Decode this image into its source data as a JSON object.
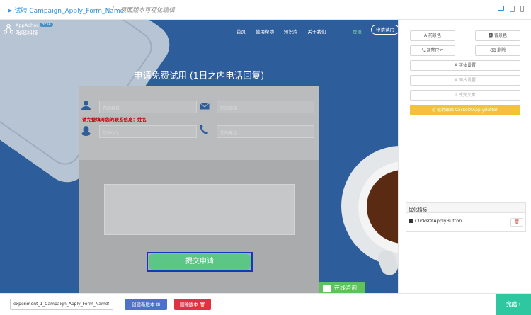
{
  "topbar": {
    "title": "试验 Campaign_Apply_Form_Name",
    "separator": "/",
    "subtitle": "页面版本可视化编辑"
  },
  "site": {
    "logo_en": "AppAdhoc",
    "logo_beta": "BETA",
    "logo_cn": "吆喝科技",
    "nav": [
      "首页",
      "使用帮助",
      "知识库",
      "关于我们"
    ],
    "login": "登录",
    "trial": "申请试用",
    "headline": "申请免费试用 (1日之内电话回复)",
    "form": {
      "name_placeholder": "您的姓名",
      "email_placeholder": "您的邮箱",
      "qq_placeholder": "您的QQ",
      "phone_placeholder": "您的电话",
      "error": "请完整填写您的联系信息：姓名",
      "submit": "提交申请"
    },
    "chat": "在线咨询"
  },
  "panel": {
    "foreground": "前景色",
    "background": "背景色",
    "resize": "调整尺寸",
    "delete": "删除",
    "font": "字体设置",
    "image": "图片设置",
    "text": "改变文本",
    "tracking": "取消跟踪 ClicksOfApplyButton",
    "metrics_title": "优化指标",
    "metric": "ClicksOfApplyButton"
  },
  "bottombar": {
    "version_select": "experiment_1_Campaign_Apply_Form_Name",
    "create": "创建新版本",
    "remove": "删除版本",
    "done": "完成"
  },
  "colors": {
    "accent": "#2f8fd8",
    "canvas_bg": "#2d5d9a",
    "submit": "#5cc686",
    "warn": "#f3c13a",
    "done": "#2ec7a0",
    "create": "#4b73c9",
    "remove": "#e2323f",
    "error": "#c00000"
  }
}
